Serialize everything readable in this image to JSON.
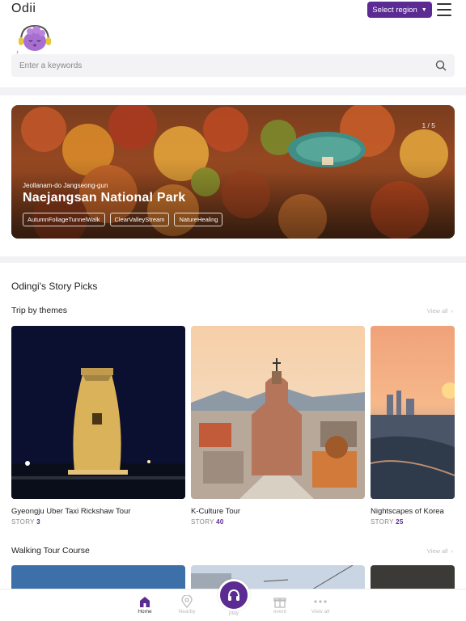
{
  "header": {
    "logo_text": "Odii",
    "region_button_label": "Select region",
    "search_placeholder": "Enter a keywords"
  },
  "hero": {
    "counter": "1 / 5",
    "region": "Jeollanam-do Jangseong-gun",
    "title": "Naejangsan National Park",
    "tags": [
      "AutumnFoliageTunnelWalk",
      "ClearValleyStream",
      "NatureHealing"
    ]
  },
  "sections": {
    "story_picks_title": "Odingi's Story Picks",
    "trip_by_themes_title": "Trip by themes",
    "walking_tour_title": "Walking Tour Course",
    "view_all_label": "View all"
  },
  "theme_cards": [
    {
      "title": "Gyeongju Uber Taxi Rickshaw Tour",
      "story_label": "STORY",
      "story_count": "3"
    },
    {
      "title": "K-Culture Tour",
      "story_label": "STORY",
      "story_count": "40"
    },
    {
      "title": "Nightscapes of Korea",
      "story_label": "STORY",
      "story_count": "25"
    }
  ],
  "bottom_nav": {
    "home": "Home",
    "nearby": "Nearby",
    "play": "play",
    "event": "event",
    "view_all": "View all"
  },
  "colors": {
    "brand_purple": "#5b2a93",
    "icon_gray": "#bbbbbb"
  }
}
